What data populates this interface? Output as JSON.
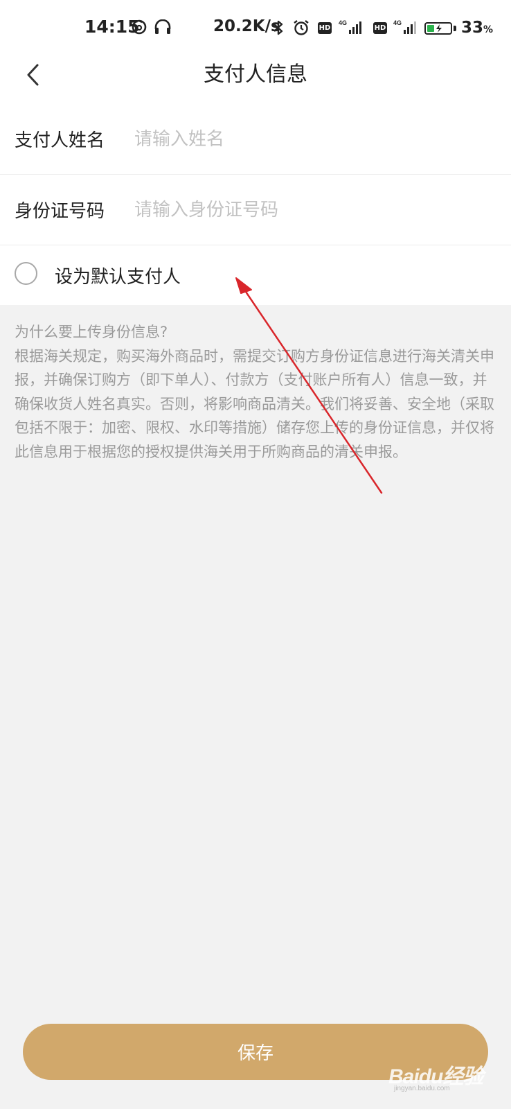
{
  "status_bar": {
    "time": "14:15",
    "network_speed": "20.2K/s",
    "hd_label": "HD",
    "network_type": "4G",
    "battery_level": "33",
    "battery_unit": "%"
  },
  "nav": {
    "title": "支付人信息"
  },
  "form": {
    "name_label": "支付人姓名",
    "name_placeholder": "请输入姓名",
    "name_value": "",
    "id_label": "身份证号码",
    "id_placeholder": "请输入身份证号码",
    "id_value": "",
    "default_label": "设为默认支付人",
    "default_checked": false
  },
  "info": {
    "question": "为什么要上传身份信息?",
    "body": "根据海关规定，购买海外商品时，需提交订购方身份证信息进行海关清关申报，并确保订购方（即下单人）、付款方（支付账户所有人）信息一致，并确保收货人姓名真实。否则，将影响商品清关。我们将妥善、安全地（采取包括不限于：加密、限权、水印等措施）储存您上传的身份证信息，并仅将此信息用于根据您的授权提供海关用于所购商品的清关申报。"
  },
  "save_label": "保存",
  "watermark": {
    "text": "Baidu经验",
    "sub": "jingyan.baidu.com"
  },
  "colors": {
    "accent": "#d1a86b",
    "annotation_arrow": "#d9262b",
    "battery": "#2bb24c"
  },
  "icons": {
    "back": "chevron-left-icon",
    "radio": "radio-unchecked-icon"
  }
}
